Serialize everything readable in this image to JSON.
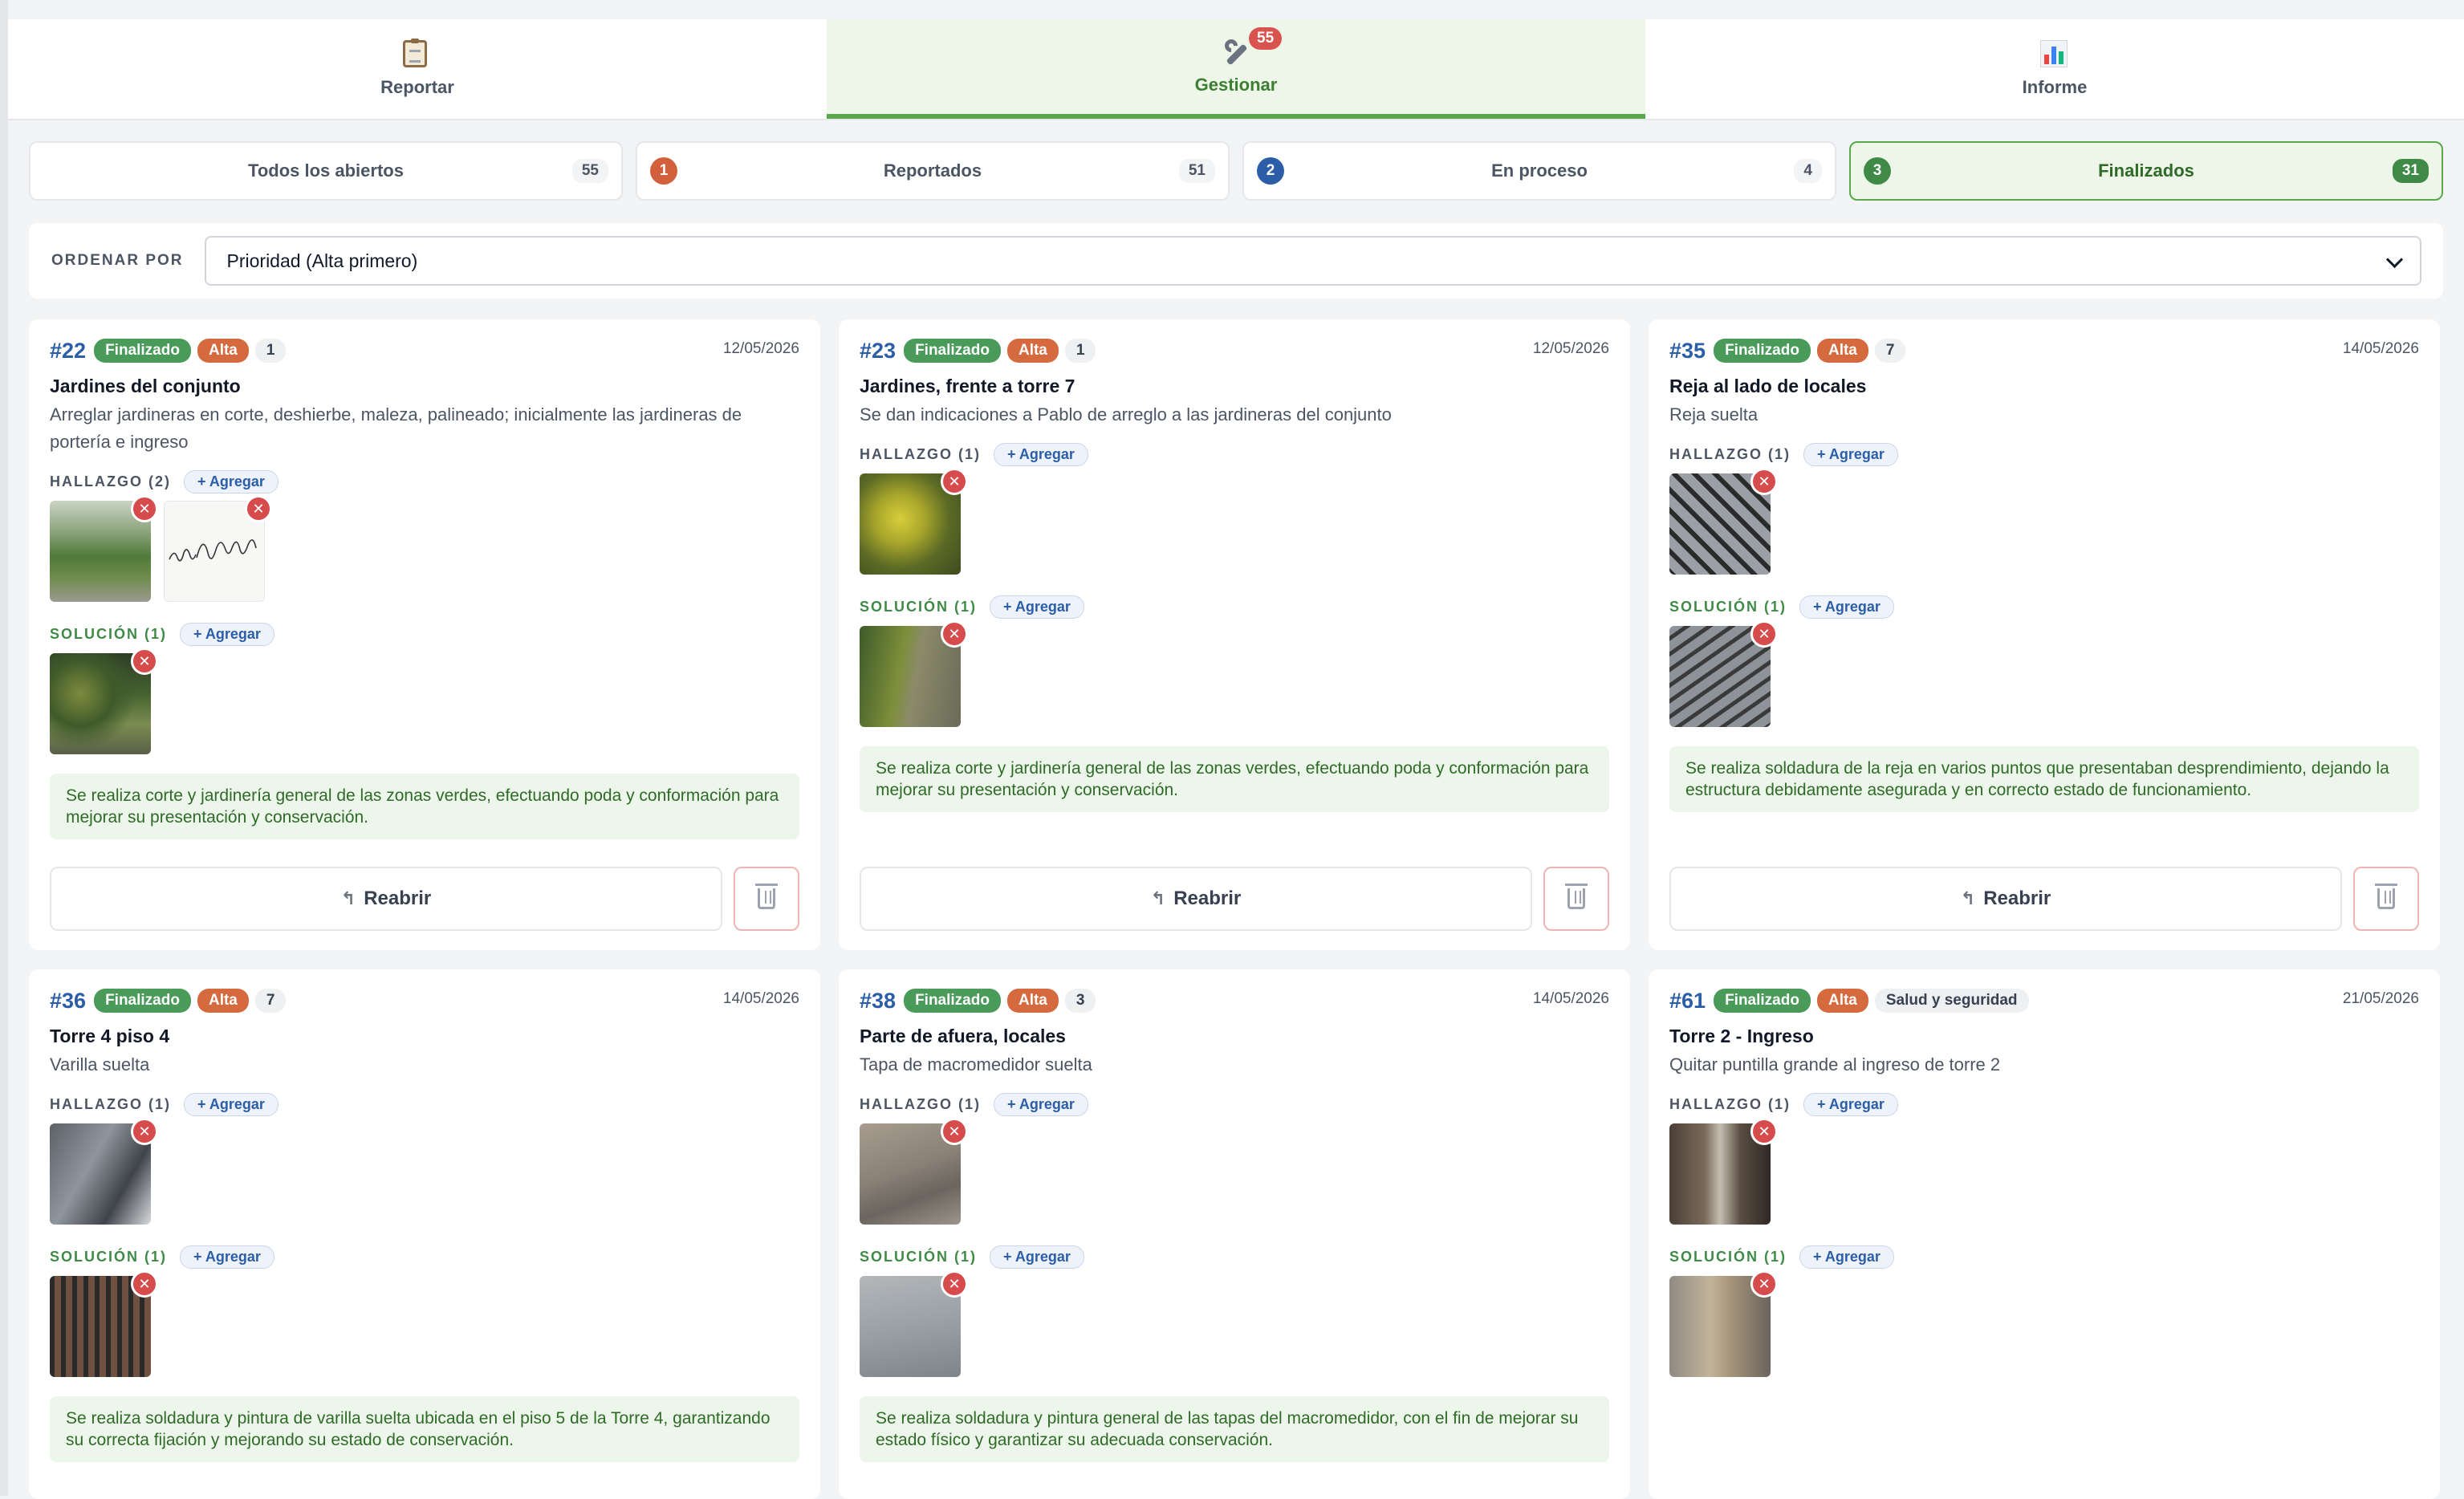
{
  "tabs": [
    {
      "label": "Reportar",
      "icon": "clipboard-icon"
    },
    {
      "label": "Gestionar",
      "icon": "wrench-icon",
      "badge": "55",
      "active": true
    },
    {
      "label": "Informe",
      "icon": "bar-chart-icon"
    }
  ],
  "filters": [
    {
      "label": "Todos los abiertos",
      "count": "55"
    },
    {
      "label": "Reportados",
      "count": "51",
      "num": "1",
      "color": "#d3603c"
    },
    {
      "label": "En proceso",
      "count": "4",
      "num": "2",
      "color": "#2b5ea7"
    },
    {
      "label": "Finalizados",
      "count": "31",
      "num": "3",
      "color": "#3f8a46",
      "active": true
    }
  ],
  "sort": {
    "label": "ORDENAR POR",
    "value": "Prioridad (Alta primero)"
  },
  "labels": {
    "add": "+ Agregar",
    "reopen": "Reabrir",
    "hallazgo1": "HALLAZGO (1)",
    "hallazgo2": "HALLAZGO (2)",
    "solucion1": "SOLUCIÓN (1)"
  },
  "cards": [
    {
      "id": "#22",
      "status": "Finalizado",
      "priority": "Alta",
      "extra": "1",
      "date": "12/05/2026",
      "title": "Jardines del conjunto",
      "description": "Arreglar jardineras en corte, deshierbe, maleza, palineado; inicialmente las jardineras de portería e ingreso",
      "note": "Se realiza corte y jardinería general de las zonas verdes, efectuando poda y conformación para mejorar su presentación y conservación.",
      "signature": "mila Rodríg"
    },
    {
      "id": "#23",
      "status": "Finalizado",
      "priority": "Alta",
      "extra": "1",
      "date": "12/05/2026",
      "title": "Jardines, frente a torre 7",
      "description": "Se dan indicaciones a Pablo de arreglo a las jardineras del conjunto",
      "note": "Se realiza corte y jardinería general de las zonas verdes, efectuando poda y conformación para mejorar su presentación y conservación."
    },
    {
      "id": "#35",
      "status": "Finalizado",
      "priority": "Alta",
      "extra": "7",
      "date": "14/05/2026",
      "title": "Reja al lado de locales",
      "description": "Reja suelta",
      "note": "Se realiza soldadura de la reja en varios puntos que presentaban desprendimiento, dejando la estructura debidamente asegurada y en correcto estado de funcionamiento."
    },
    {
      "id": "#36",
      "status": "Finalizado",
      "priority": "Alta",
      "extra": "7",
      "date": "14/05/2026",
      "title": "Torre 4 piso 4",
      "description": "Varilla suelta",
      "note": "Se realiza soldadura y pintura de varilla suelta ubicada en el piso 5 de la Torre 4, garantizando su correcta fijación y mejorando su estado de conservación."
    },
    {
      "id": "#38",
      "status": "Finalizado",
      "priority": "Alta",
      "extra": "3",
      "date": "14/05/2026",
      "title": "Parte de afuera, locales",
      "description": "Tapa de macromedidor suelta",
      "note": "Se realiza soldadura y pintura general de las tapas del macromedidor, con el fin de mejorar su estado físico y garantizar su adecuada conservación."
    },
    {
      "id": "#61",
      "status": "Finalizado",
      "priority": "Alta",
      "extra": "Salud y seguridad",
      "date": "21/05/2026",
      "title": "Torre 2 - Ingreso",
      "description": "Quitar puntilla grande al ingreso de torre 2"
    }
  ]
}
